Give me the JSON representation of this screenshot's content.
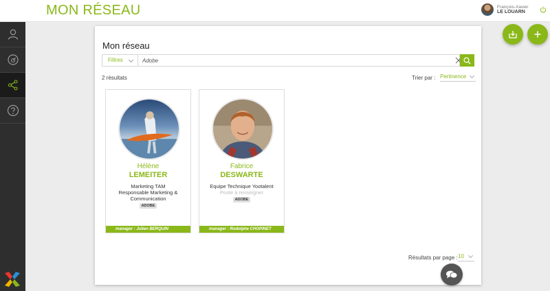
{
  "header": {
    "title": "MON RÉSEAU",
    "user_first": "François-Xavier",
    "user_last": "LE LOUARN"
  },
  "sidebar": {
    "items": [
      {
        "icon": "user-icon",
        "active": false
      },
      {
        "icon": "dashboard-icon",
        "active": false
      },
      {
        "icon": "share-network-icon",
        "active": true
      },
      {
        "icon": "help-icon",
        "active": false
      }
    ]
  },
  "panel": {
    "title": "Mon réseau",
    "filter_label": "Filtres",
    "search_value": "Adobe",
    "result_count": "2 résultats",
    "sort_label": "Trier par :",
    "sort_value": "Pertinence",
    "per_page_label": "Résultats par page :",
    "per_page_value": "10"
  },
  "cards": [
    {
      "first_name": "Hélène",
      "last_name": "LEMEITER",
      "line1": "Marketing TAM",
      "line2": "Responsable Marketing &",
      "line3": "Communication",
      "tag": "ADOBE",
      "manager": "manager : Julien BERQUIN"
    },
    {
      "first_name": "Fabrice",
      "last_name": "DESWARTE",
      "line1": "Equipe Technique Yootalent",
      "line2": "Poste à renseigner",
      "tag": "ADOBE",
      "manager": "manager : Rodolphe CHOPINET"
    }
  ],
  "colors": {
    "accent": "#8ab819",
    "sidebar": "#2e2e2e",
    "chat": "#555555"
  }
}
